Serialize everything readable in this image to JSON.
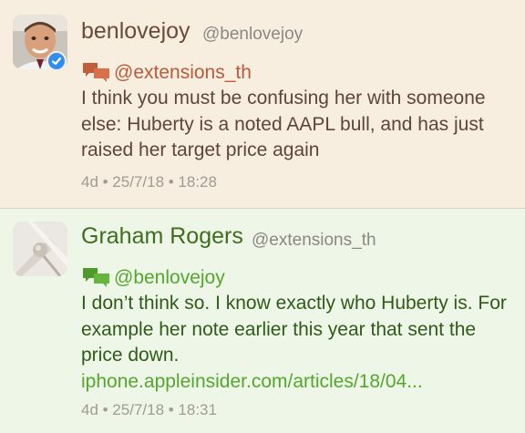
{
  "tweets": [
    {
      "name": "benlovejoy",
      "handle": "@benlovejoy",
      "reply_to": "@extensions_th",
      "text": "I think you must be confusing her with someone else: Huberty is a noted AAPL bull, and has just raised her target price again",
      "meta": "4d • 25/7/18 • 18:28",
      "verified": true,
      "reply_icon": "conversation-bubbles-icon"
    },
    {
      "name": "Graham Rogers",
      "handle": "@extensions_th",
      "reply_to": "@benlovejoy",
      "text_plain": "I don’t think so. I know exactly who Huberty is. For example her note earlier this year that sent the price down. ",
      "link": "iphone.appleinsider.com/articles/18/04...",
      "meta": "4d • 25/7/18 • 18:31",
      "verified": false,
      "reply_icon": "conversation-bubbles-icon"
    }
  ],
  "colors": {
    "tweet1_bg": "#f7eee0",
    "tweet2_bg": "#eef7e7",
    "name1": "#6a4a38",
    "name2": "#3f6d1e",
    "mention1": "#b75b3a",
    "link_green": "#55a52f"
  }
}
